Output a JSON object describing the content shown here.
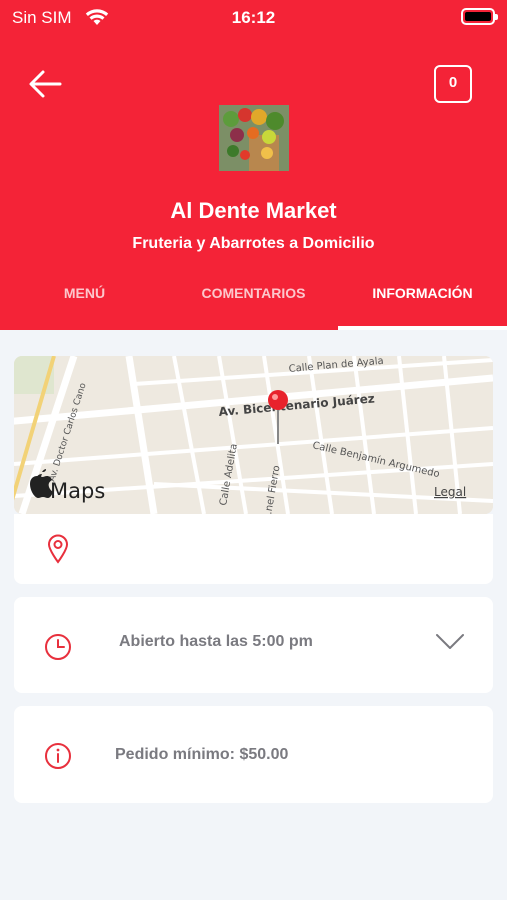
{
  "status_bar": {
    "carrier": "Sin SIM",
    "time": "16:12"
  },
  "header": {
    "cart_count": "0",
    "store_name": "Al Dente Market",
    "store_category": "Fruteria y Abarrotes a Domicilio"
  },
  "tabs": [
    {
      "label": "MENÚ",
      "active": false
    },
    {
      "label": "COMENTARIOS",
      "active": false
    },
    {
      "label": "INFORMACIÓN",
      "active": true
    }
  ],
  "map": {
    "brand": "Maps",
    "legal": "Legal",
    "streets": {
      "main_avenue": "Av. Bicentenario Juárez",
      "plan_de_ayala": "Calle Plan de Ayala",
      "doctor_carlos": "Av. Doctor Carlos Cano",
      "adelita": "Calle Adelita",
      "fierro": "...nel Fierro",
      "benjamin": "Calle Benjamín Argumedo"
    }
  },
  "info": {
    "address": "",
    "hours": "Abierto hasta las 5:00 pm",
    "min_order": "Pedido mínimo: $50.00"
  },
  "colors": {
    "brand_red": "#f42337",
    "icon_red": "#e8303d",
    "text_gray": "#7a7a80",
    "background": "#f2f5f9"
  }
}
